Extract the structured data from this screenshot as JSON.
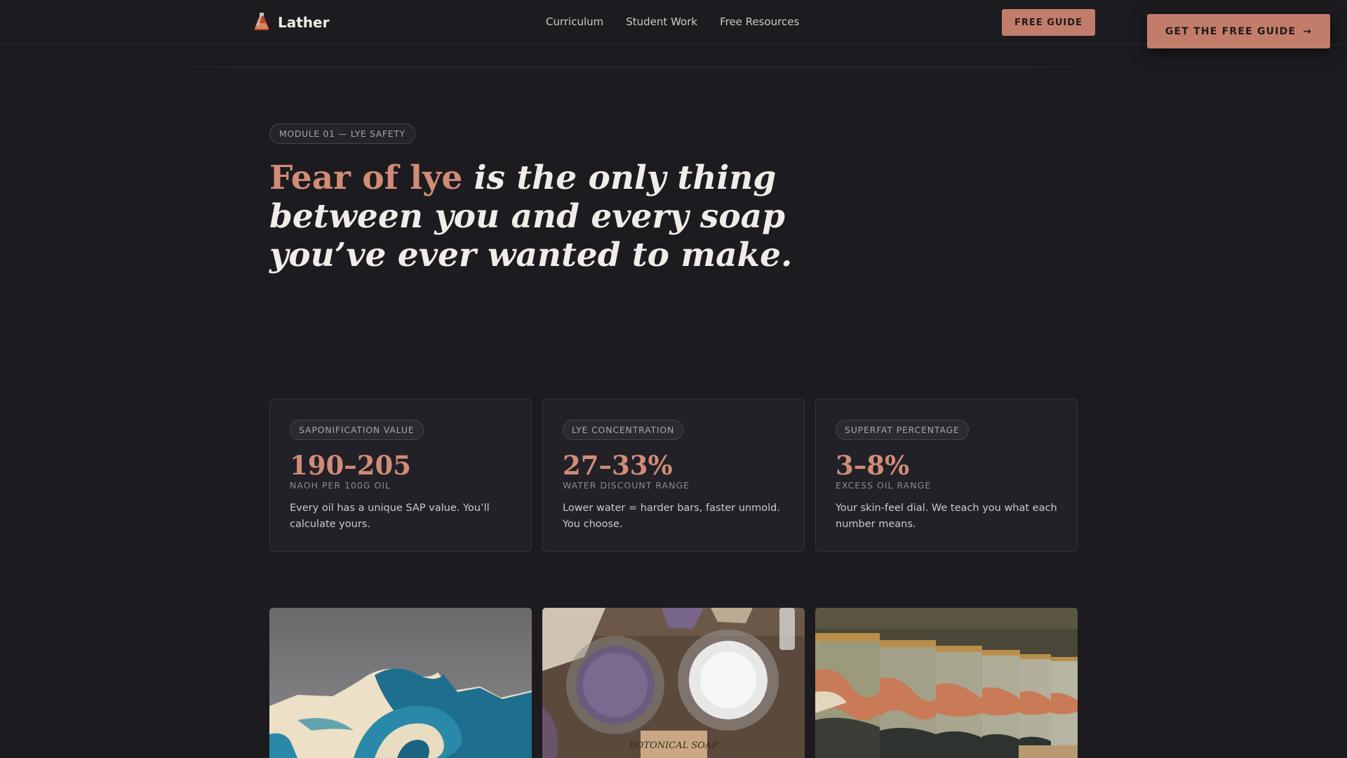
{
  "header": {
    "brand": "Lather",
    "nav": [
      "Curriculum",
      "Student Work",
      "Free Resources"
    ],
    "cta_small": "FREE GUIDE",
    "cta_float": "GET THE FREE GUIDE"
  },
  "hero": {
    "badge": "MODULE 01 — LYE SAFETY",
    "headline_accent": "Fear of lye",
    "headline_rest": " is the only thing between you and every soap you’ve ever wanted to make."
  },
  "stats": [
    {
      "tag": "SAPONIFICATION VALUE",
      "value": "190–205",
      "unit": "NAOH PER 100G OIL",
      "text": "Every oil has a unique SAP value. You’ll calculate yours."
    },
    {
      "tag": "LYE CONCENTRATION",
      "value": "27–33%",
      "unit": "WATER DISCOUNT RANGE",
      "text": "Lower water = harder bars, faster unmold. You choose."
    },
    {
      "tag": "SUPERFAT PERCENTAGE",
      "value": "3–8%",
      "unit": "EXCESS OIL RANGE",
      "text": "Your skin-feel dial. We teach you what each number means."
    }
  ],
  "gallery": {
    "label_text": "BOTONICAL SOAP"
  },
  "colors": {
    "background": "#1c1b20",
    "accent": "#c27d6a",
    "card": "#222128"
  },
  "icons": {
    "brand": "flask-icon",
    "cta": "arrow-right-icon"
  }
}
